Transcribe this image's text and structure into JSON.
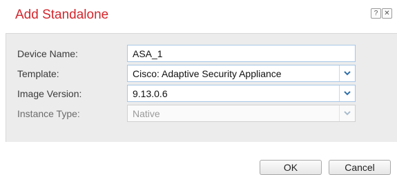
{
  "dialog": {
    "title": "Add Standalone",
    "help_label": "?",
    "close_label": "✕"
  },
  "form": {
    "device_name": {
      "label": "Device Name:",
      "value": "ASA_1"
    },
    "template": {
      "label": "Template:",
      "value": "Cisco: Adaptive Security Appliance"
    },
    "image_version": {
      "label": "Image Version:",
      "value": "9.13.0.6"
    },
    "instance_type": {
      "label": "Instance Type:",
      "value": "Native"
    }
  },
  "buttons": {
    "ok": "OK",
    "cancel": "Cancel"
  },
  "colors": {
    "title": "#d3262c",
    "field_border": "#a6c6e6",
    "dropdown_arrow": "#2f6fa8",
    "panel_bg": "#ececec"
  },
  "icons": {
    "help": "help-icon",
    "close": "close-icon",
    "dropdown": "chevron-down-icon"
  }
}
